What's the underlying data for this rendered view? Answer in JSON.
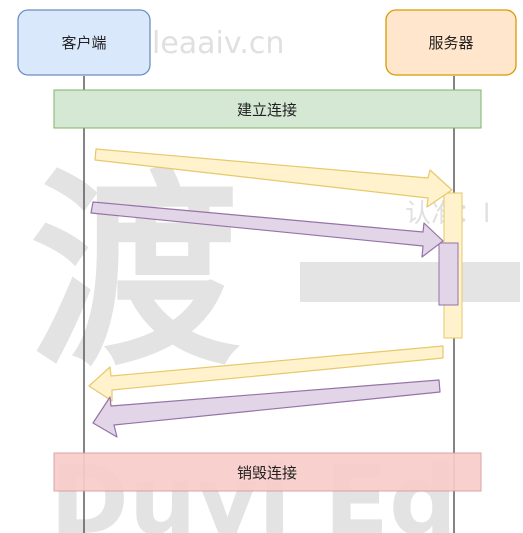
{
  "participants": {
    "client": {
      "label": "客户端",
      "fill": "#dae8fc",
      "stroke": "#6c8ebf"
    },
    "server": {
      "label": "服务器",
      "fill": "#ffe6cc",
      "stroke": "#d79b00"
    }
  },
  "phases": {
    "connect": {
      "label": "建立连接",
      "fill": "#d5e8d4",
      "stroke": "#82b366"
    },
    "disconnect": {
      "label": "销毁连接",
      "fill": "#f8cecc",
      "stroke": "#d99d9d"
    }
  },
  "colors": {
    "request_arrow": "#fff2cc",
    "request_arrow_stroke": "#e6c96a",
    "message_arrow": "#e1d5e7",
    "message_arrow_stroke": "#9673a6",
    "lifeline": "#333333"
  },
  "watermarks": {
    "top": "认准：leaaiv.cn",
    "right": "认准：l",
    "big_char": "渡",
    "big_latin": "Duvi Ed"
  }
}
